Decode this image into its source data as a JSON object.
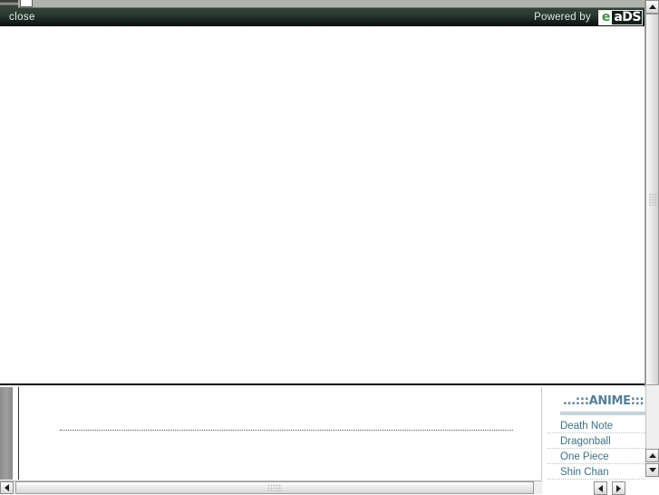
{
  "header": {
    "close_label": "close",
    "powered_by_label": "Powered by",
    "brand_logo_prefix": "e",
    "brand_logo_suffix": "aDS",
    "background_color": "#2b3a33",
    "text_color": "#e9eeea"
  },
  "main": {
    "content": ""
  },
  "lower": {
    "document_pane": {
      "separator": "dotted-rule"
    }
  },
  "anime_widget": {
    "title": "...:::ANIME:::",
    "title_color": "#577f94",
    "link_color": "#3f6f85",
    "items": [
      {
        "label": "Death Note"
      },
      {
        "label": "Dragonball"
      },
      {
        "label": "One Piece"
      },
      {
        "label": "Shin Chan"
      }
    ]
  },
  "scrollbars": {
    "outer_vertical": {
      "position": "right",
      "thumb_top_percent": 0
    },
    "bottom_horizontal": {
      "position": "bottom",
      "thumb_left_percent": 3
    },
    "anime_vertical": {
      "position": "right"
    },
    "anime_horizontal": {
      "position": "bottom"
    }
  },
  "icons": {
    "arrow_up": "arrow-up-icon",
    "arrow_down": "arrow-down-icon",
    "arrow_left": "arrow-left-icon",
    "arrow_right": "arrow-right-icon"
  }
}
